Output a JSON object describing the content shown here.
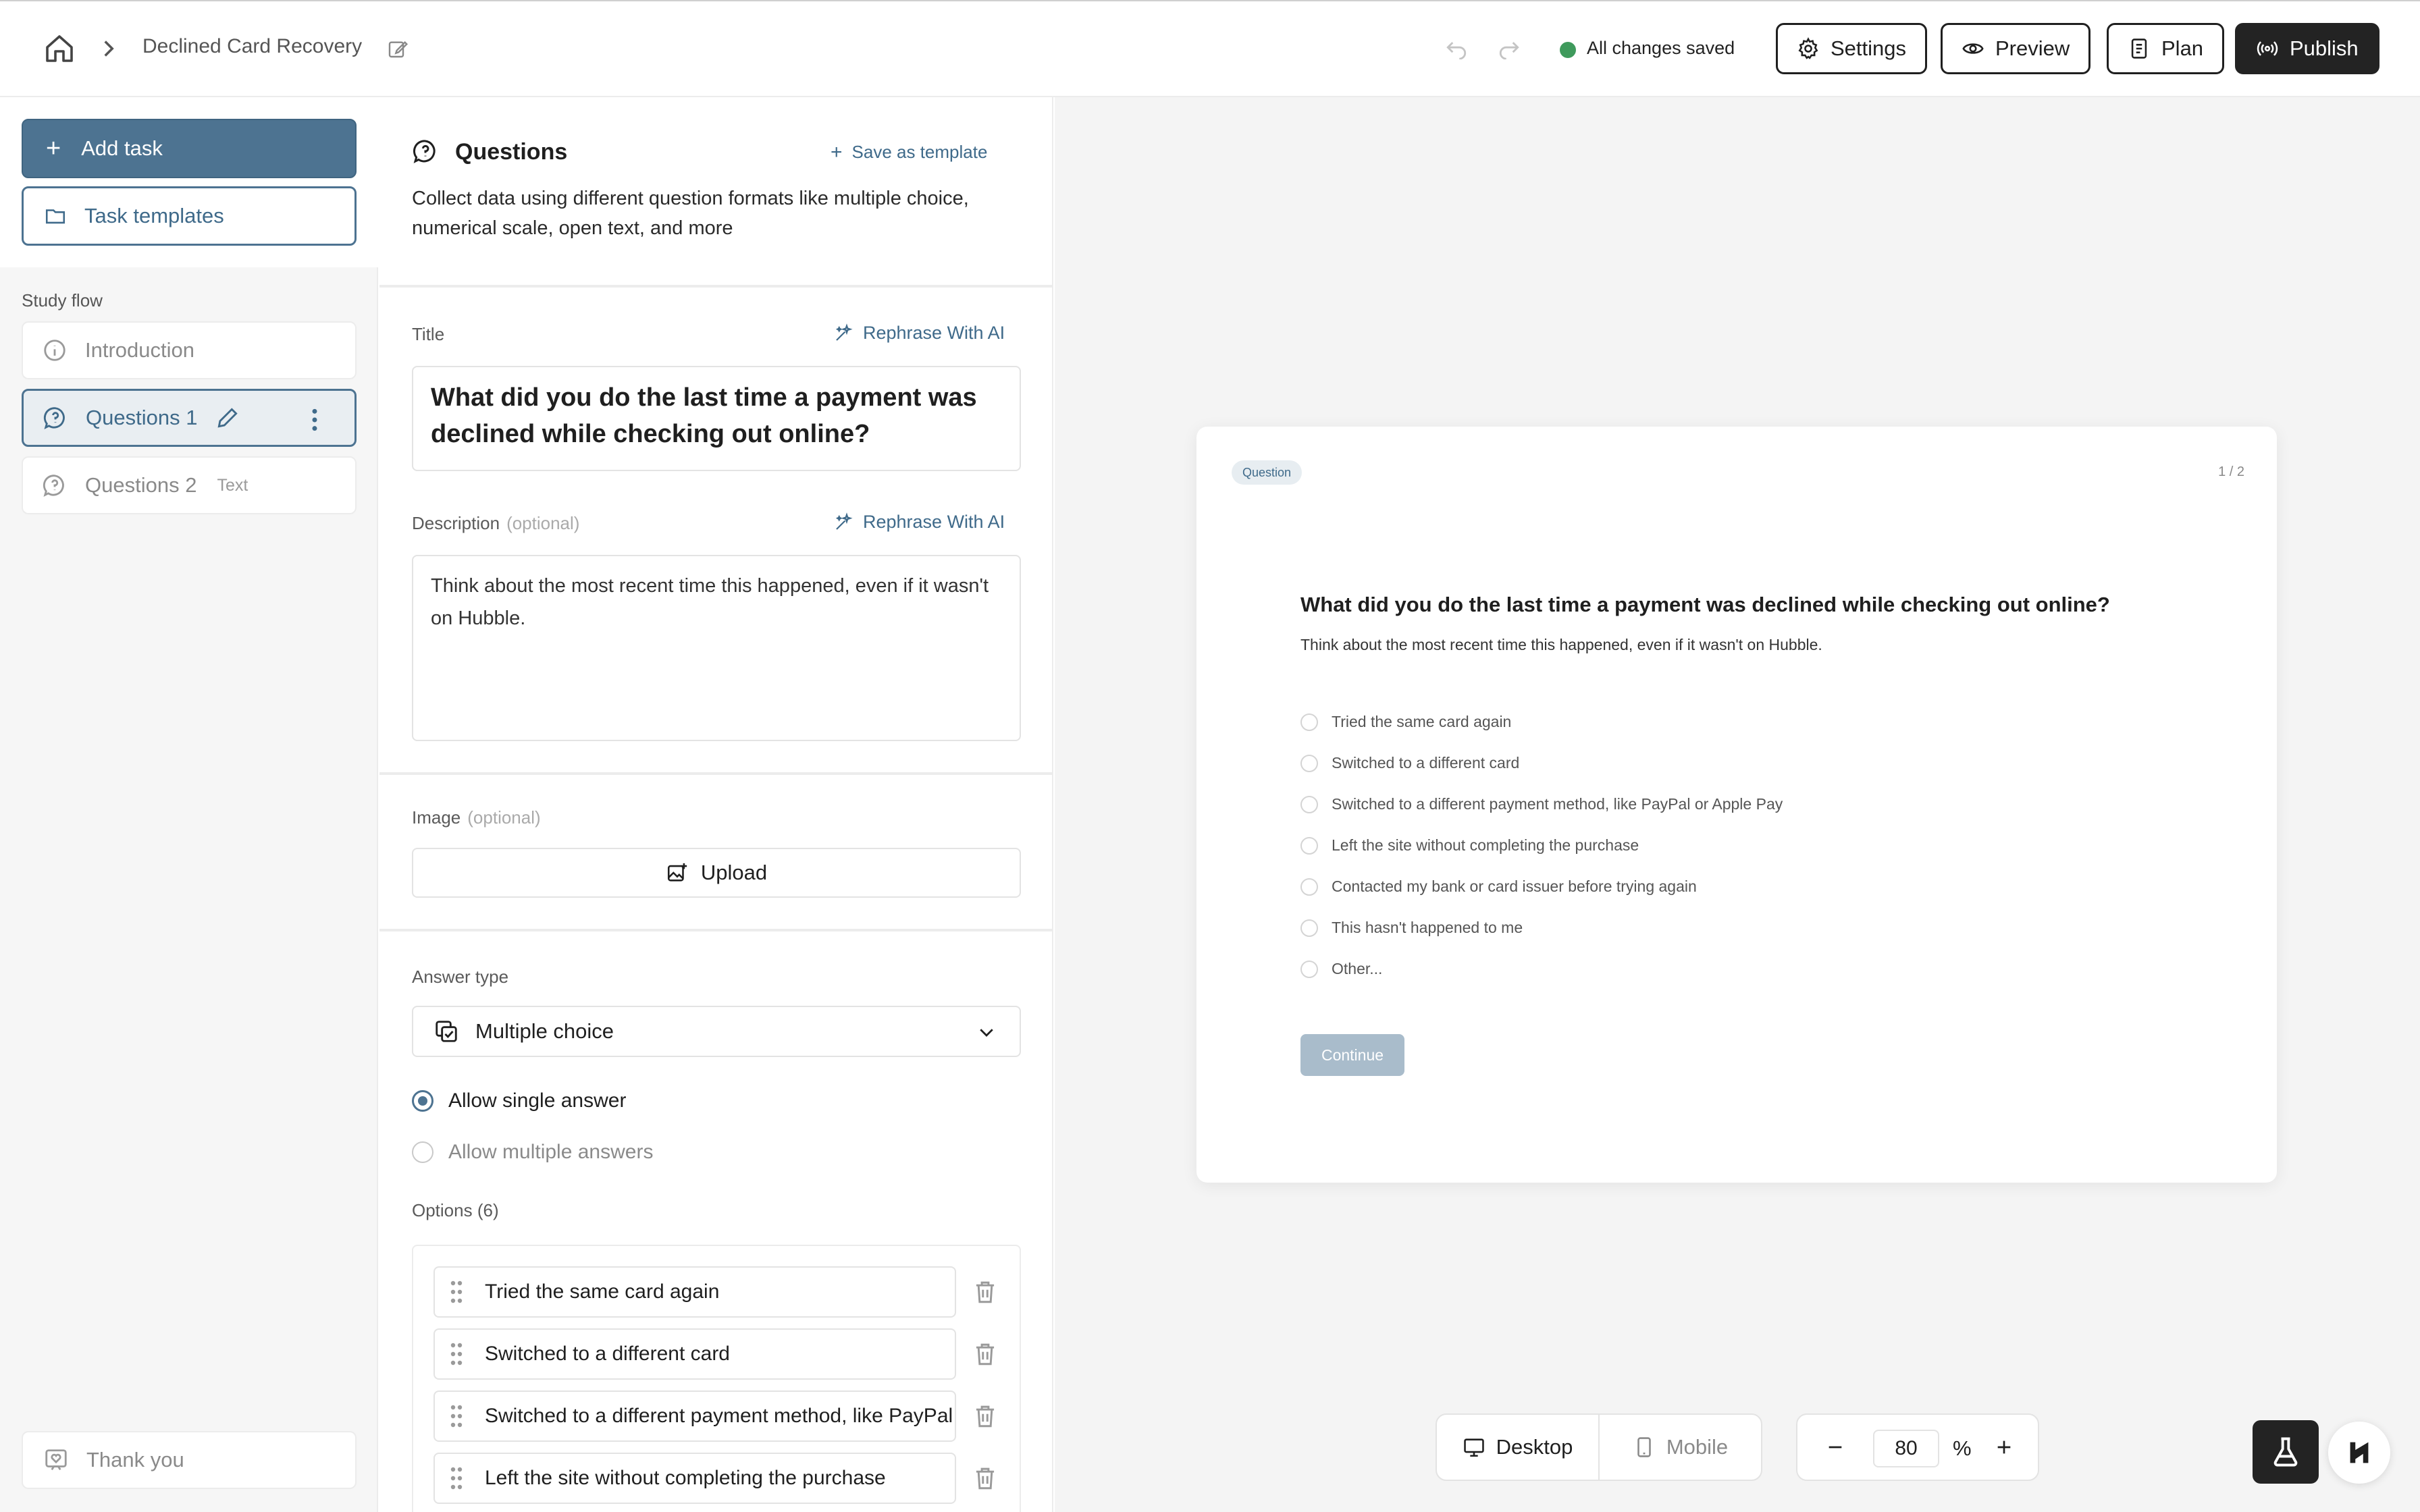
{
  "header": {
    "project_title": "Declined Card Recovery",
    "save_status": "All changes saved",
    "buttons": {
      "settings": "Settings",
      "preview": "Preview",
      "plan": "Plan",
      "publish": "Publish"
    }
  },
  "sidebar": {
    "add_task": "Add task",
    "task_templates": "Task templates",
    "study_flow_label": "Study flow",
    "items": [
      {
        "label": "Introduction"
      },
      {
        "label": "Questions 1"
      },
      {
        "label": "Questions 2",
        "tag": "Text"
      }
    ],
    "thank_you": "Thank you"
  },
  "editor": {
    "heading": "Questions",
    "save_as_template": "Save as template",
    "description": "Collect data using different question formats like multiple choice, numerical scale, open text, and more",
    "title_label": "Title",
    "rephrase_label": "Rephrase With AI",
    "title_value": "What did you do the last time a payment was declined while checking out online?",
    "description_label": "Description",
    "optional_label": "(optional)",
    "description_value": "Think about the most recent time this happened, even if it wasn't on Hubble.",
    "image_label": "Image",
    "upload_label": "Upload",
    "answer_type_label": "Answer type",
    "answer_type_value": "Multiple choice",
    "allow_single": "Allow single answer",
    "allow_multiple": "Allow multiple answers",
    "options_label": "Options (6)",
    "options": [
      "Tried the same card again",
      "Switched to a different card",
      "Switched to a different payment method, like PayPal or Apple Pay",
      "Left the site without completing the purchase"
    ]
  },
  "preview": {
    "badge": "Question",
    "page_count": "1 / 2",
    "title": "What did you do the last time a payment was declined while checking out online?",
    "description": "Think about the most recent time this happened, even if it wasn't on Hubble.",
    "options": [
      "Tried the same card again",
      "Switched to a different card",
      "Switched to a different payment method, like PayPal or Apple Pay",
      "Left the site without completing the purchase",
      "Contacted my bank or card issuer before trying again",
      "This hasn't happened to me",
      "Other..."
    ],
    "continue": "Continue",
    "device_desktop": "Desktop",
    "device_mobile": "Mobile",
    "zoom_value": "80",
    "zoom_unit": "%"
  },
  "colors": {
    "accent": "#4d7391",
    "saved": "#3f9a5c",
    "dark": "#232323"
  }
}
